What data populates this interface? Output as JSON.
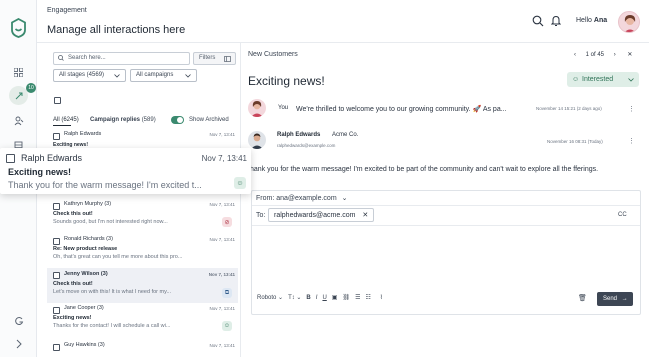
{
  "header": {
    "eyebrow": "Engagement",
    "title": "Manage all interactions here",
    "greeting": "Hello",
    "user": "Ana"
  },
  "rail": {
    "badge": "10"
  },
  "list": {
    "search_placeholder": "Search here...",
    "filters_label": "Filters",
    "stage_filter": "All stages (4569)",
    "campaign_filter": "All campaigns",
    "tab_all_label": "All",
    "tab_all_count": "(6245)",
    "tab_campaign_label": "Campaign replies",
    "tab_campaign_count": "(589)",
    "show_archived": "Show Archived",
    "rows": [
      {
        "name": "Ralph Edwards",
        "date": "Nov 7, 13:41",
        "subject": "Exciting news!",
        "preview": ""
      },
      {
        "name": "Kathryn Murphy (3)",
        "date": "Nov 7, 13:41",
        "subject": "Check this out!",
        "preview": "Sounds good, but I'm not interested right now..."
      },
      {
        "name": "Ronald Richards (3)",
        "date": "Nov 7, 13:41",
        "subject": "Re: New product release",
        "preview": "Oh, that's great can you tell me more about this pro..."
      },
      {
        "name": "Jenny Wilson (3)",
        "date": "Nov 7, 13:41",
        "subject": "Check this out!",
        "preview": "Let's move on with this! It is what I need for my..."
      },
      {
        "name": "Jane Cooper (3)",
        "date": "Nov 7, 13:41",
        "subject": "Exciting news!",
        "preview": "Thanks for the contact! I will schedule a call wi..."
      },
      {
        "name": "Guy Hawkins (3)",
        "date": "Nov 7, 13:41",
        "subject": "",
        "preview": ""
      }
    ]
  },
  "floating": {
    "name": "Ralph Edwards",
    "date": "Nov 7, 13:41",
    "subject": "Exciting news!",
    "preview": "Thank you for the warm message! I'm excited t..."
  },
  "detail": {
    "list_name": "New Customers",
    "pager": "1 of 45",
    "title": "Exciting news!",
    "status": "Interested",
    "msg1": {
      "author": "You",
      "text": "We're thrilled to welcome you to our growing community. 🚀 As pa...",
      "when": "November 14 15:21 (2 days ago)"
    },
    "msg2": {
      "name": "Ralph Edwards",
      "company": "Acme Co.",
      "email": "ralphedwards@example.com",
      "when": "November 16 08:31 (Today)",
      "body": "hank you for the warm message! I'm excited to be part of the community and can't wait to explore all the fferings."
    }
  },
  "composer": {
    "from_label": "From:",
    "from_value": "ana@example.com",
    "to_label": "To:",
    "to_value": "ralphedwards@acme.com",
    "cc_label": "CC",
    "font": "Roboto",
    "send_label": "Send"
  },
  "colors": {
    "accent": "#3b8a6f",
    "send": "#3d4654",
    "interested_bg": "#dfeee7"
  }
}
